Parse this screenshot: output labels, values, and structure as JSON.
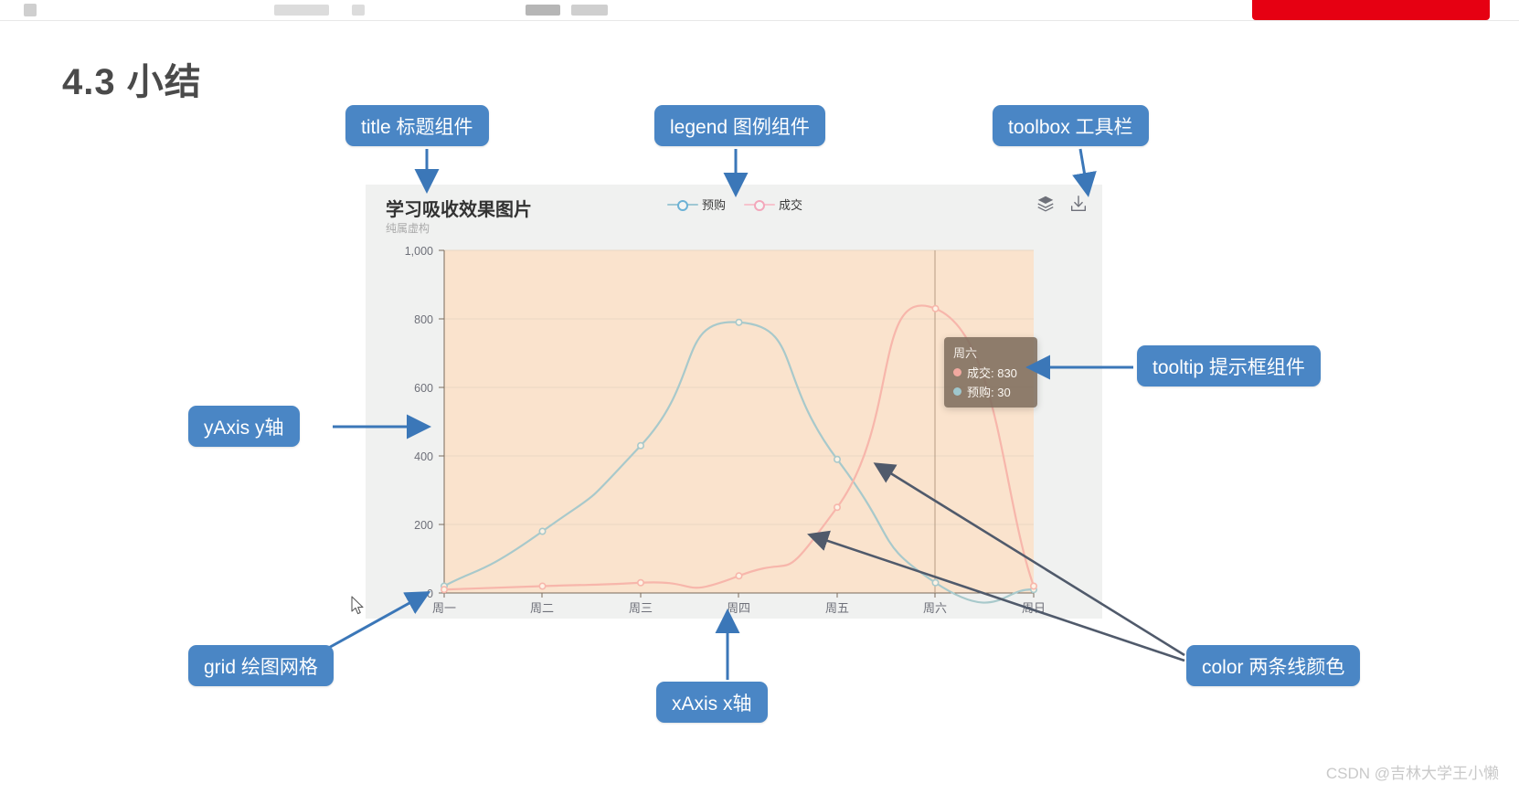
{
  "page": {
    "heading": "4.3 小结",
    "watermark": "CSDN @吉林大学王小懒"
  },
  "chart": {
    "title": "学习吸收效果图片",
    "subtitle": "纯属虚构",
    "toolbox": [
      {
        "name": "data-view-icon",
        "label": "数据视图"
      },
      {
        "name": "download-icon",
        "label": "保存为图片"
      }
    ],
    "tooltip": {
      "title": "周六",
      "rows": [
        {
          "label": "成交: 830",
          "color": "#f2a9a0"
        },
        {
          "label": "预购: 30",
          "color": "#9fc7cd"
        }
      ]
    }
  },
  "chart_data": {
    "type": "line",
    "title": "学习吸收效果图片",
    "subtitle": "纯属虚构",
    "xlabel": "",
    "ylabel": "",
    "categories": [
      "周一",
      "周二",
      "周三",
      "周四",
      "周五",
      "周六",
      "周日"
    ],
    "series": [
      {
        "name": "预购",
        "color": "#a8c9cb",
        "symbol": "circle",
        "smooth": true,
        "values": [
          20,
          180,
          430,
          790,
          390,
          30,
          10
        ]
      },
      {
        "name": "成交",
        "color": "#f7b6ab",
        "symbol": "circle",
        "smooth": true,
        "values": [
          10,
          20,
          30,
          50,
          250,
          830,
          20
        ]
      }
    ],
    "ylim": [
      0,
      1000
    ],
    "yticks": [
      0,
      200,
      400,
      600,
      800,
      1000
    ],
    "ytick_labels": [
      "0",
      "200",
      "400",
      "600",
      "800",
      "1,000"
    ],
    "grid": true,
    "grid_background": "#fae3cd",
    "legend": {
      "position": "top-center",
      "entries": [
        "预购",
        "成交"
      ]
    },
    "axis_pointer": {
      "type": "line",
      "at_category": "周六"
    }
  },
  "annotations": [
    {
      "id": "title",
      "label": "title 标题组件"
    },
    {
      "id": "legend",
      "label": "legend 图例组件"
    },
    {
      "id": "toolbox",
      "label": "toolbox 工具栏"
    },
    {
      "id": "tooltip",
      "label": "tooltip 提示框组件"
    },
    {
      "id": "yaxis",
      "label": "yAxis y轴"
    },
    {
      "id": "grid",
      "label": "grid 绘图网格"
    },
    {
      "id": "xaxis",
      "label": "xAxis x轴"
    },
    {
      "id": "color",
      "label": "color 两条线颜色"
    }
  ]
}
